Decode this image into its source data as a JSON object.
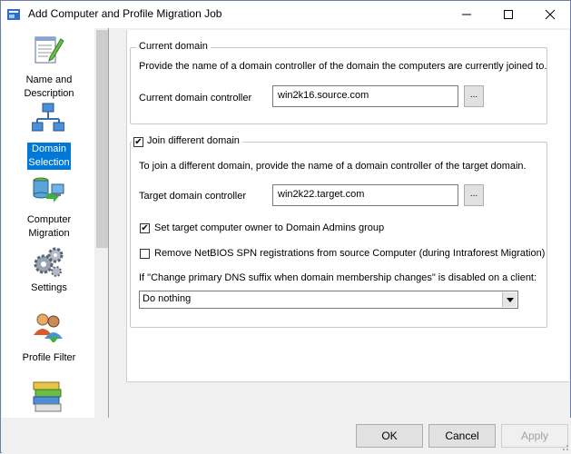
{
  "window": {
    "title": "Add Computer and Profile Migration Job"
  },
  "sidebar": {
    "items": [
      {
        "label_line1": "Name and",
        "label_line2": "Description",
        "icon": "notepad-pencil-icon",
        "selected": false
      },
      {
        "label_line1": "Domain",
        "label_line2": "Selection",
        "icon": "network-computers-icon",
        "selected": true
      },
      {
        "label_line1": "Computer",
        "label_line2": "Migration",
        "icon": "server-computer-icon",
        "selected": false
      },
      {
        "label_line1": "Settings",
        "label_line2": "",
        "icon": "gears-icon",
        "selected": false
      },
      {
        "label_line1": "Profile Filter",
        "label_line2": "",
        "icon": "users-filter-icon",
        "selected": false
      },
      {
        "label_line1": "",
        "label_line2": "",
        "icon": "books-stack-icon",
        "selected": false
      }
    ]
  },
  "current_domain": {
    "legend": "Current domain",
    "description": "Provide the name of a domain controller of the domain the computers are currently joined to.",
    "controller_label": "Current domain controller",
    "controller_value": "win2k16.source.com",
    "browse_label": "..."
  },
  "join_domain": {
    "legend": "Join different domain",
    "checked": true,
    "description": "To join a different domain, provide the name of a domain controller of the target domain.",
    "controller_label": "Target domain controller",
    "controller_value": "win2k22.target.com",
    "browse_label": "...",
    "owner_option": {
      "label": "Set target computer owner to Domain Admins group",
      "checked": true
    },
    "spn_option": {
      "label": "Remove NetBIOS SPN registrations from source Computer (during Intraforest Migration)",
      "checked": false
    },
    "dns_label": "If \"Change primary DNS suffix when domain membership changes\" is disabled on a client:",
    "dns_selected": "Do nothing"
  },
  "footer": {
    "ok_label": "OK",
    "cancel_label": "Cancel",
    "apply_label": "Apply"
  }
}
